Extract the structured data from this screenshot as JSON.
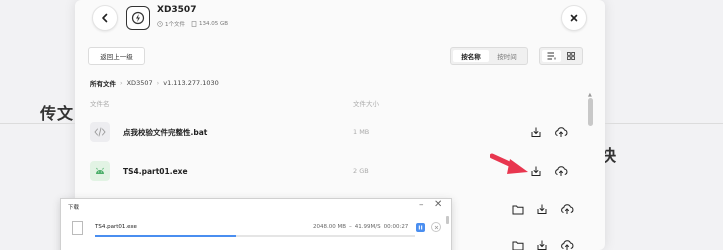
{
  "background": {
    "left_text": "传文",
    "right_text": "快"
  },
  "dialog": {
    "title": "XD3507",
    "file_count": "1个文件",
    "total_size": "134.05 GB",
    "back_label": "返回上一级",
    "sort": {
      "by_name": "按名称",
      "by_time": "按时间"
    },
    "breadcrumb": {
      "root": "所有文件",
      "folder": "XD3507",
      "version": "v1.113.277.1030"
    },
    "columns": {
      "name": "文件名",
      "size": "文件大小"
    },
    "files": [
      {
        "name": "点我校验文件完整性.bat",
        "size": "1 MB",
        "icon": "code-file-icon"
      },
      {
        "name": "TS4.part01.exe",
        "size": "2 GB",
        "icon": "android-file-icon"
      }
    ]
  },
  "download_window": {
    "title": "下载",
    "minimize": "–",
    "close": "✕",
    "items": [
      {
        "name": "TS4.part01.exe",
        "size": "2048.00 MB",
        "speed": "41.99M/S",
        "time": "00:00:27",
        "progress": 0.44
      }
    ]
  },
  "colors": {
    "accent": "#4a8ef0",
    "arrow": "#e8364f",
    "exe_icon_bg": "#e2f3e4"
  }
}
